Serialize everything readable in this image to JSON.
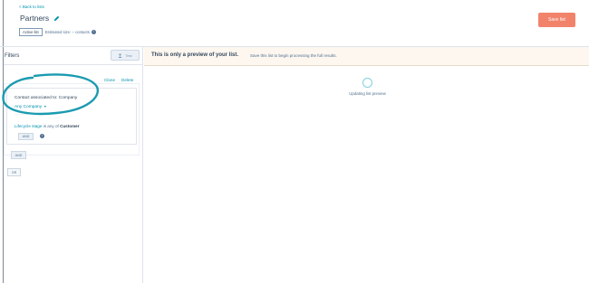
{
  "header": {
    "back_link": "< Back to lists",
    "title": "Partners",
    "badge": "Active list",
    "estimated_size": "Estimated size: -- contacts",
    "save_label": "Save list"
  },
  "sidebar": {
    "filters_title": "Filters",
    "test_label": "Test",
    "clone_label": "Clone",
    "delete_label": "Delete",
    "condition_title": "Contact associated to: Company",
    "any_company_label": "Any Company",
    "lifecycle_prefix": "Lifecycle stage",
    "lifecycle_operator": " is any of ",
    "lifecycle_value": "Customer",
    "and_inner_label": "AND",
    "and_outer_label": "AND",
    "or_label": "OR"
  },
  "banner": {
    "bold_text": "This is only a preview of your list.",
    "text": "Save this list to begin processing the full results."
  },
  "preview": {
    "status_text": "Updating list preview"
  },
  "colors": {
    "accent": "#0091ae",
    "save_button": "#f2836b",
    "annotation": "#1a9bb0"
  }
}
